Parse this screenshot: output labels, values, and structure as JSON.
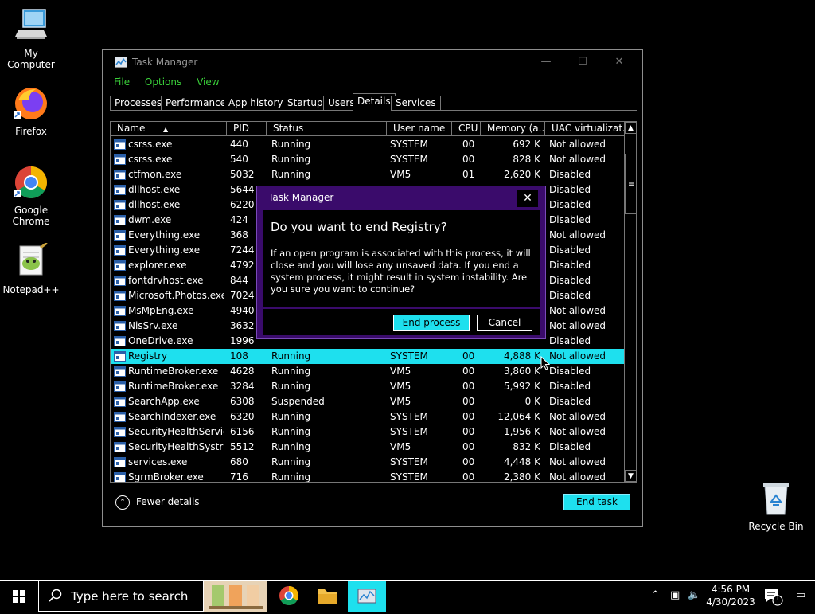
{
  "desktop": {
    "icons": [
      {
        "label": "My Computer"
      },
      {
        "label": "Firefox"
      },
      {
        "label": "Google Chrome"
      },
      {
        "label": "Notepad++"
      },
      {
        "label": "Recycle Bin"
      }
    ]
  },
  "window": {
    "title": "Task Manager",
    "menu": [
      "File",
      "Options",
      "View"
    ],
    "tabs": [
      "Processes",
      "Performance",
      "App history",
      "Startup",
      "Users",
      "Details",
      "Services"
    ],
    "active_tab": "Details",
    "columns": [
      "Name",
      "PID",
      "Status",
      "User name",
      "CPU",
      "Memory (a...",
      "UAC virtualizat..."
    ],
    "rows": [
      {
        "name": "csrss.exe",
        "pid": "440",
        "status": "Running",
        "user": "SYSTEM",
        "cpu": "00",
        "mem": "692 K",
        "uac": "Not allowed"
      },
      {
        "name": "csrss.exe",
        "pid": "540",
        "status": "Running",
        "user": "SYSTEM",
        "cpu": "00",
        "mem": "828 K",
        "uac": "Not allowed"
      },
      {
        "name": "ctfmon.exe",
        "pid": "5032",
        "status": "Running",
        "user": "VM5",
        "cpu": "01",
        "mem": "2,620 K",
        "uac": "Disabled"
      },
      {
        "name": "dllhost.exe",
        "pid": "5644",
        "status": "",
        "user": "",
        "cpu": "",
        "mem": "",
        "uac": "Disabled"
      },
      {
        "name": "dllhost.exe",
        "pid": "6220",
        "status": "",
        "user": "",
        "cpu": "",
        "mem": "",
        "uac": "Disabled"
      },
      {
        "name": "dwm.exe",
        "pid": "424",
        "status": "",
        "user": "",
        "cpu": "",
        "mem": "",
        "uac": "Disabled"
      },
      {
        "name": "Everything.exe",
        "pid": "368",
        "status": "",
        "user": "",
        "cpu": "",
        "mem": "",
        "uac": "Not allowed"
      },
      {
        "name": "Everything.exe",
        "pid": "7244",
        "status": "",
        "user": "",
        "cpu": "",
        "mem": "",
        "uac": "Disabled"
      },
      {
        "name": "explorer.exe",
        "pid": "4792",
        "status": "",
        "user": "",
        "cpu": "",
        "mem": "",
        "uac": "Disabled"
      },
      {
        "name": "fontdrvhost.exe",
        "pid": "844",
        "status": "",
        "user": "",
        "cpu": "",
        "mem": "",
        "uac": "Disabled"
      },
      {
        "name": "Microsoft.Photos.exe",
        "pid": "7024",
        "status": "",
        "user": "",
        "cpu": "",
        "mem": "",
        "uac": "Disabled"
      },
      {
        "name": "MsMpEng.exe",
        "pid": "4940",
        "status": "",
        "user": "",
        "cpu": "",
        "mem": "",
        "uac": "Not allowed"
      },
      {
        "name": "NisSrv.exe",
        "pid": "3632",
        "status": "",
        "user": "",
        "cpu": "",
        "mem": "",
        "uac": "Not allowed"
      },
      {
        "name": "OneDrive.exe",
        "pid": "1996",
        "status": "",
        "user": "",
        "cpu": "",
        "mem": "",
        "uac": "Disabled"
      },
      {
        "name": "Registry",
        "pid": "108",
        "status": "Running",
        "user": "SYSTEM",
        "cpu": "00",
        "mem": "4,888 K",
        "uac": "Not allowed"
      },
      {
        "name": "RuntimeBroker.exe",
        "pid": "4628",
        "status": "Running",
        "user": "VM5",
        "cpu": "00",
        "mem": "3,860 K",
        "uac": "Disabled"
      },
      {
        "name": "RuntimeBroker.exe",
        "pid": "3284",
        "status": "Running",
        "user": "VM5",
        "cpu": "00",
        "mem": "5,992 K",
        "uac": "Disabled"
      },
      {
        "name": "SearchApp.exe",
        "pid": "6308",
        "status": "Suspended",
        "user": "VM5",
        "cpu": "00",
        "mem": "0 K",
        "uac": "Disabled"
      },
      {
        "name": "SearchIndexer.exe",
        "pid": "6320",
        "status": "Running",
        "user": "SYSTEM",
        "cpu": "00",
        "mem": "12,064 K",
        "uac": "Not allowed"
      },
      {
        "name": "SecurityHealthServic...",
        "pid": "6156",
        "status": "Running",
        "user": "SYSTEM",
        "cpu": "00",
        "mem": "1,956 K",
        "uac": "Not allowed"
      },
      {
        "name": "SecurityHealthSystra...",
        "pid": "5512",
        "status": "Running",
        "user": "VM5",
        "cpu": "00",
        "mem": "832 K",
        "uac": "Disabled"
      },
      {
        "name": "services.exe",
        "pid": "680",
        "status": "Running",
        "user": "SYSTEM",
        "cpu": "00",
        "mem": "4,448 K",
        "uac": "Not allowed"
      },
      {
        "name": "SgrmBroker.exe",
        "pid": "716",
        "status": "Running",
        "user": "SYSTEM",
        "cpu": "00",
        "mem": "2,380 K",
        "uac": "Not allowed"
      }
    ],
    "selected_row": "Registry",
    "fewer_details": "Fewer details",
    "end_task": "End task"
  },
  "dialog": {
    "title": "Task Manager",
    "question": "Do you want to end Registry?",
    "message": "If an open program is associated with this process, it will close and you will lose any unsaved data. If you end a system process, it might result in system instability. Are you sure you want to continue?",
    "end_process": "End process",
    "cancel": "Cancel"
  },
  "taskbar": {
    "search_placeholder": "Type here to search",
    "time": "4:56 PM",
    "date": "4/30/2023",
    "notification_count": "1"
  },
  "colors": {
    "accent": "#1ee0ee",
    "menu_green": "#3ad13a",
    "dialog_purple": "#3a0b6b"
  }
}
